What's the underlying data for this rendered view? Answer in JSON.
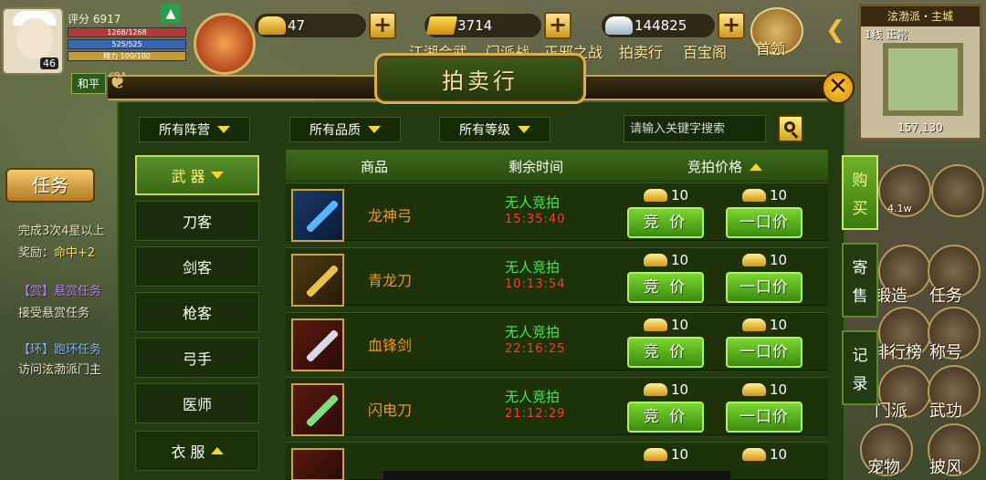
{
  "player": {
    "score_label": "评分 6917",
    "hp": "1268/1268",
    "mp": "525/525",
    "sp": "精力 100/100",
    "level": "46",
    "mode": "和平"
  },
  "currency": {
    "gold_ingot": "47",
    "gold_bar": "3714",
    "silver": "144825"
  },
  "top_nav": {
    "items": [
      "江湖会武",
      "门派战",
      "正邪之战",
      "拍卖行",
      "百宝阁"
    ],
    "boss": "首领"
  },
  "minimap": {
    "title": "泫渤派・主城",
    "line": "1线 正常",
    "coords": "157,130"
  },
  "side_tasks": {
    "task_button": "任务",
    "line1": "完成3次4星以上",
    "line2_prefix": "奖励：",
    "line2_value": "命中+2",
    "line3_tag": "【赏】",
    "line3": "悬赏任务",
    "line4": "接受悬赏任务",
    "line5_tag": "【环】",
    "line5": "跑环任务",
    "line6": "访问泫渤派门主"
  },
  "right_icons": {
    "forge": "锻造",
    "task": "任务",
    "ranking": "排行榜",
    "title": "称号",
    "sect": "门派",
    "martial": "武功",
    "pet": "宠物",
    "cloak": "披风",
    "power": "4.1w"
  },
  "auction": {
    "title": "拍卖行",
    "filters": {
      "faction": "所有阵营",
      "quality": "所有品质",
      "level": "所有等级",
      "search_placeholder": "请输入关键字搜索"
    },
    "categories": {
      "weapon": "武 器",
      "items": [
        "刀客",
        "剑客",
        "枪客",
        "弓手",
        "医师"
      ],
      "clothes": "衣 服"
    },
    "headers": {
      "item": "商品",
      "time": "剩余时间",
      "price": "竞拍价格"
    },
    "bid_button": "竞 价",
    "buyout_button": "一口价",
    "rows": [
      {
        "name": "龙神弓",
        "status": "无人竞拍",
        "remaining": "15:35:40",
        "bid": "10",
        "buyout": "10"
      },
      {
        "name": "青龙刀",
        "status": "无人竞拍",
        "remaining": "10:13:54",
        "bid": "10",
        "buyout": "10"
      },
      {
        "name": "血锋剑",
        "status": "无人竞拍",
        "remaining": "22:16:25",
        "bid": "10",
        "buyout": "10"
      },
      {
        "name": "闪电刀",
        "status": "无人竞拍",
        "remaining": "21:12:29",
        "bid": "10",
        "buyout": "10"
      },
      {
        "name": "",
        "status": "",
        "remaining": "",
        "bid": "10",
        "buyout": "10"
      }
    ],
    "side_tabs": {
      "buy": [
        "购",
        "买"
      ],
      "sell": [
        "寄",
        "售"
      ],
      "record": [
        "记",
        "录"
      ]
    }
  }
}
